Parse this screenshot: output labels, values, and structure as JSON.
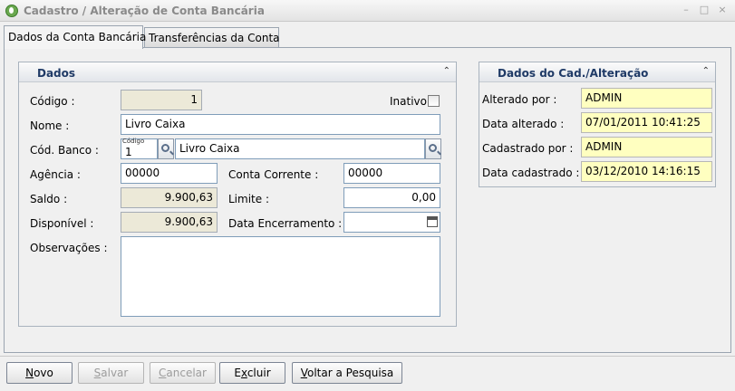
{
  "window": {
    "title": "Cadastro / Alteração de Conta Bancária",
    "minimize": "–",
    "restore": "□",
    "close": "×"
  },
  "tabs": [
    {
      "label": "Dados da Conta Bancária",
      "active": true
    },
    {
      "label": "Transferências da Conta",
      "active": false
    }
  ],
  "dados": {
    "header": "Dados",
    "codigo_label": "Código :",
    "codigo_value": "1",
    "inativo_label": "Inativo",
    "inativo_checked": false,
    "nome_label": "Nome :",
    "nome_value": "Livro Caixa",
    "cod_banco_label": "Cód. Banco :",
    "cod_banco_caption": "Código",
    "cod_banco_value": "1",
    "banco_nome_value": "Livro Caixa",
    "agencia_label": "Agência :",
    "agencia_value": "00000",
    "conta_corrente_label": "Conta Corrente :",
    "conta_corrente_value": "00000",
    "saldo_label": "Saldo :",
    "saldo_value": "9.900,63",
    "limite_label": "Limite :",
    "limite_value": "0,00",
    "disponivel_label": "Disponível :",
    "disponivel_value": "9.900,63",
    "data_encerramento_label": "Data Encerramento :",
    "data_encerramento_value": "",
    "observacoes_label": "Observações :",
    "observacoes_value": ""
  },
  "cadastro": {
    "header": "Dados do Cad./Alteração",
    "alterado_por_label": "Alterado por :",
    "alterado_por_value": "ADMIN",
    "data_alterado_label": "Data alterado :",
    "data_alterado_value": "07/01/2011 10:41:25",
    "cadastrado_por_label": "Cadastrado por :",
    "cadastrado_por_value": "ADMIN",
    "data_cadastrado_label": "Data cadastrado :",
    "data_cadastrado_value": "03/12/2010 14:16:15"
  },
  "buttons": {
    "novo": {
      "mnemonic": "N",
      "rest": "ovo"
    },
    "salvar": {
      "mnemonic": "S",
      "rest": "alvar"
    },
    "cancelar": {
      "mnemonic": "C",
      "rest": "ancelar"
    },
    "excluir": {
      "pre": "E",
      "mnemonic": "x",
      "rest": "cluir"
    },
    "voltar": {
      "mnemonic": "V",
      "rest": "oltar a Pesquisa"
    }
  },
  "colors": {
    "group_title": "#1f3a66",
    "readonly_bg": "#ece9d8",
    "audit_bg": "#ffffc0"
  }
}
